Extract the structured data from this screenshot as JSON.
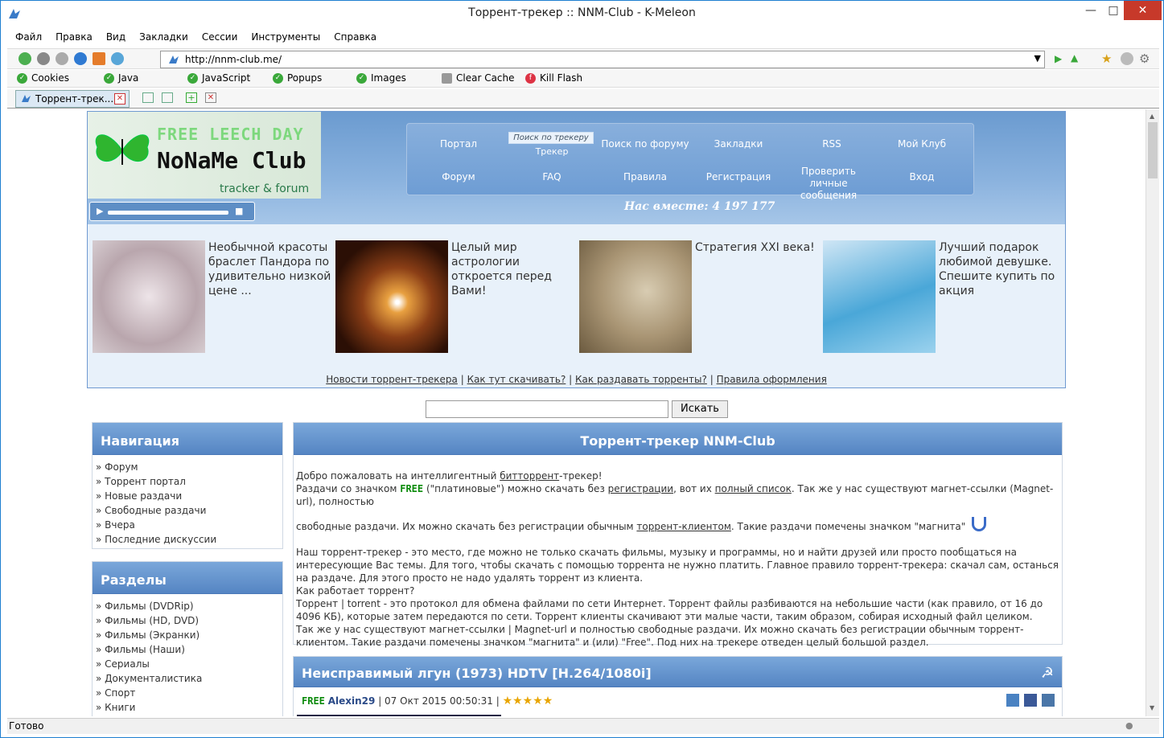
{
  "window": {
    "title": "Торрент-трекер :: NNM-Club - K-Meleon"
  },
  "menubar": [
    "Файл",
    "Правка",
    "Вид",
    "Закладки",
    "Сессии",
    "Инструменты",
    "Справка"
  ],
  "address": {
    "url": "http://nnm-club.me/"
  },
  "plugins": [
    "Cookies",
    "Java",
    "JavaScript",
    "Popups",
    "Images",
    "Clear Cache",
    "Kill Flash"
  ],
  "tab": {
    "label": "Торрент-трек..."
  },
  "status": "Готово",
  "header": {
    "free_leech": "FREE LEECH DAY",
    "logo": "NoNaMe Club",
    "tagline": "tracker & forum",
    "tracker_search": "Поиск по трекеру",
    "menu_row1": [
      "Портал",
      "Трекер",
      "Поиск по форуму",
      "Закладки",
      "RSS",
      "Мой Клуб"
    ],
    "menu_row2": [
      "Форум",
      "FAQ",
      "Правила",
      "Регистрация",
      "Проверить личные сообщения",
      "Вход"
    ],
    "together": "Нас вместе: 4 197 177"
  },
  "ads": [
    {
      "text": "Необычной красоты браслет Пандора по удивительно низкой цене ..."
    },
    {
      "text": "Целый мир астрологии откроется перед Вами!"
    },
    {
      "text": "Стратегия XXI века!"
    },
    {
      "text": "Лучший подарок любимой девушке. Спешите купить по акция"
    }
  ],
  "links": [
    "Новости торрент-трекера",
    "Как тут скачивать?",
    "Как раздавать торренты?",
    "Правила оформления"
  ],
  "search": {
    "button": "Искать"
  },
  "nav": {
    "title": "Навигация",
    "items": [
      "Форум",
      "Торрент портал",
      "Новые раздачи",
      "Свободные раздачи",
      "Вчера",
      "Последние дискуссии"
    ]
  },
  "sections": {
    "title": "Разделы",
    "items": [
      "Фильмы (DVDRip)",
      "Фильмы (HD, DVD)",
      "Фильмы (Экранки)",
      "Фильмы (Наши)",
      "Сериалы",
      "Документалистика",
      "Спорт",
      "Книги"
    ]
  },
  "welcome": {
    "title": "Торрент-трекер NNM-Club",
    "p1a": "Добро пожаловать на интеллигентный ",
    "p1link": "биттоppент",
    "p1b": "-трекер!",
    "p2a": "Раздачи со значком ",
    "free": "FREE",
    "p2b": " (\"платиновые\") можно скачать без ",
    "p2link1": "регистрации",
    "p2c": ", вот их ",
    "p2link2": "полный список",
    "p2d": ". Так же у нас существуют магнет-ссылки (Magnet-url), полностью",
    "p3a": "свободные раздачи. Их можно скачать без регистрации обычным ",
    "p3link": "торрент-клиентом",
    "p3b": ". Такие раздачи помечены значком \"магнита\"",
    "p4": "Наш торрент-трекер - это место, где можно не только скачать фильмы, музыку и программы, но и найти друзей или просто пообщаться на интересующие Вас темы. Для того, чтобы скачать с помощью торрента не нужно платить. Главное правило торрент-трекера: скачал сам, останься на раздаче. Для этого просто не надо удалять торрент из клиента.",
    "p5": "Как работает торрент?",
    "p6": "Торрент | torrent - это протокол для обмена файлами по сети Интернет. Торрент файлы разбиваются на небольшие части (как правило, от 16 до 4096 КБ), которые затем передаются по сети. Торрент клиенты скачивают эти малые части, таким образом, собирая исходный файл целиком.",
    "p7": "Так же у нас существуют магнет-ссылки | Magnet-url и полностью свободные раздачи. Их можно скачать без регистрации обычным торрент-клиентом. Такие раздачи помечены значком \"магнита\" и (или) \"Free\". Под них на трекере отведен целый большой раздел."
  },
  "post": {
    "title": "Неисправимый лгун (1973) HDTV [H.264/1080i]",
    "free": "FREE",
    "author": "Alexin29",
    "date": "07 Окт 2015 00:50:31",
    "stars": "★★★★★",
    "rating": 5
  }
}
